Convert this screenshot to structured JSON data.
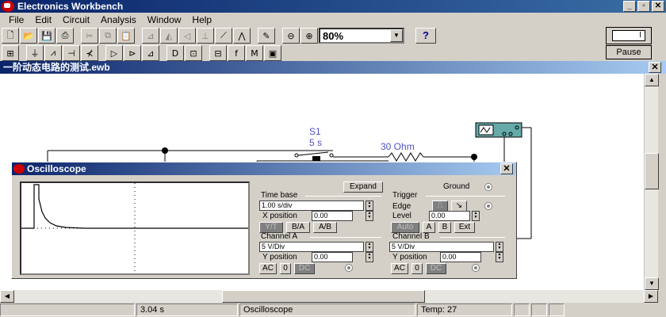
{
  "app": {
    "title": "Electronics Workbench",
    "window_buttons": [
      "_",
      "▫",
      "✕"
    ]
  },
  "menu": [
    {
      "label": "File"
    },
    {
      "label": "Edit"
    },
    {
      "label": "Circuit"
    },
    {
      "label": "Analysis"
    },
    {
      "label": "Window"
    },
    {
      "label": "Help"
    }
  ],
  "toolbar": {
    "zoom_value": "80%",
    "help_label": "?",
    "power_label": "I",
    "pause_label": "Pause"
  },
  "document": {
    "title": "一阶动态电路的测试.ewb",
    "close_label": "✕"
  },
  "circuit": {
    "switch_name": "S1",
    "switch_time": "5 s",
    "resistor_label": "30 Ohm"
  },
  "oscilloscope": {
    "title": "Oscilloscope",
    "close_label": "✕",
    "expand_label": "Expand",
    "ground_label": "Ground",
    "timebase": {
      "label": "Time base",
      "value": "1.00 s/div",
      "xpos_label": "X position",
      "xpos_value": "0.00"
    },
    "modes": [
      "Y/T",
      "B/A",
      "A/B"
    ],
    "trigger": {
      "label": "Trigger",
      "edge_label": "Edge",
      "level_label": "Level",
      "level_value": "0.00",
      "buttons": [
        "Auto",
        "A",
        "B",
        "Ext"
      ]
    },
    "channel_a": {
      "label": "Channel A",
      "value": "5 V/Div",
      "ypos_label": "Y position",
      "ypos_value": "0.00",
      "coupling": [
        "AC",
        "0",
        "DC"
      ]
    },
    "channel_b": {
      "label": "Channel B",
      "value": "5 V/Div",
      "ypos_label": "Y position",
      "ypos_value": "0.00",
      "coupling": [
        "AC",
        "0",
        "DC"
      ]
    }
  },
  "status": {
    "time": "3.04 s",
    "mode": "Oscilloscope",
    "temp": "Temp:  27"
  }
}
